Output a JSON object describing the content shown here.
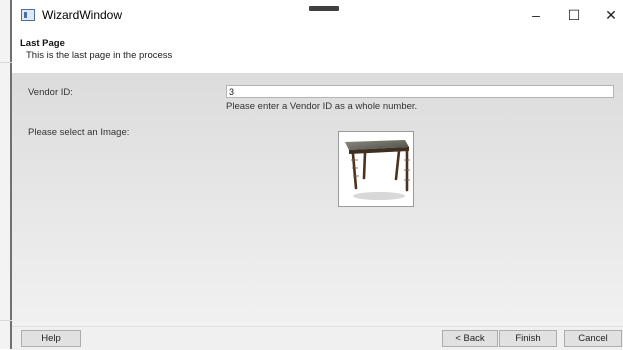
{
  "window": {
    "title": "WizardWindow",
    "minimize_glyph": "–",
    "maximize_glyph": "☐",
    "close_glyph": "✕"
  },
  "header": {
    "title": "Last Page",
    "subtitle": "This is the last page in the process"
  },
  "form": {
    "vendor_label": "Vendor ID:",
    "vendor_value": "3",
    "vendor_hint": "Please enter a Vendor ID as a whole number.",
    "image_label": "Please select an Image:",
    "image_icon": "table-photo"
  },
  "footer": {
    "help_label": "Help",
    "back_label": "< Back",
    "finish_label": "Finish",
    "cancel_label": "Cancel"
  }
}
